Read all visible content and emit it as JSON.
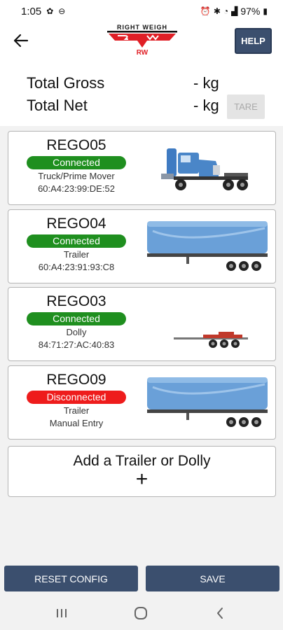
{
  "status_bar": {
    "time": "1:05",
    "battery": "97%",
    "icons": [
      "pinwheel-icon",
      "do-not-disturb-icon",
      "alarm-icon",
      "bluetooth-icon",
      "wifi-icon",
      "signal-icon",
      "battery-icon"
    ]
  },
  "header": {
    "logo_text": "RIGHT WEIGH",
    "logo_mark": "RW",
    "help_label": "HELP",
    "back_icon": "arrow-left-icon"
  },
  "totals": {
    "gross_label": "Total Gross",
    "gross_value": "- kg",
    "net_label": "Total Net",
    "net_value": "- kg",
    "tare_label": "TARE"
  },
  "units": [
    {
      "rego": "REGO05",
      "status": "Connected",
      "type": "Truck/Prime Mover",
      "detail": "60:A4:23:99:DE:52",
      "image": "truck-icon"
    },
    {
      "rego": "REGO04",
      "status": "Connected",
      "type": "Trailer",
      "detail": "60:A4:23:91:93:C8",
      "image": "trailer-icon"
    },
    {
      "rego": "REGO03",
      "status": "Connected",
      "type": "Dolly",
      "detail": "84:71:27:AC:40:83",
      "image": "dolly-icon"
    },
    {
      "rego": "REGO09",
      "status": "Disconnected",
      "type": "Trailer",
      "detail": "Manual Entry",
      "image": "trailer-icon"
    }
  ],
  "add": {
    "label": "Add a Trailer or Dolly",
    "plus": "+"
  },
  "footer": {
    "reset_label": "RESET CONFIG",
    "save_label": "SAVE"
  },
  "colors": {
    "button": "#3b4f6e",
    "connected": "#1f8f1f",
    "disconnected": "#ee1c1c",
    "logo_red": "#e01f26",
    "trailer_blue": "#6aa0d8",
    "truck_blue": "#4a86c8"
  },
  "nav": [
    "recents-icon",
    "home-icon",
    "back-icon"
  ]
}
